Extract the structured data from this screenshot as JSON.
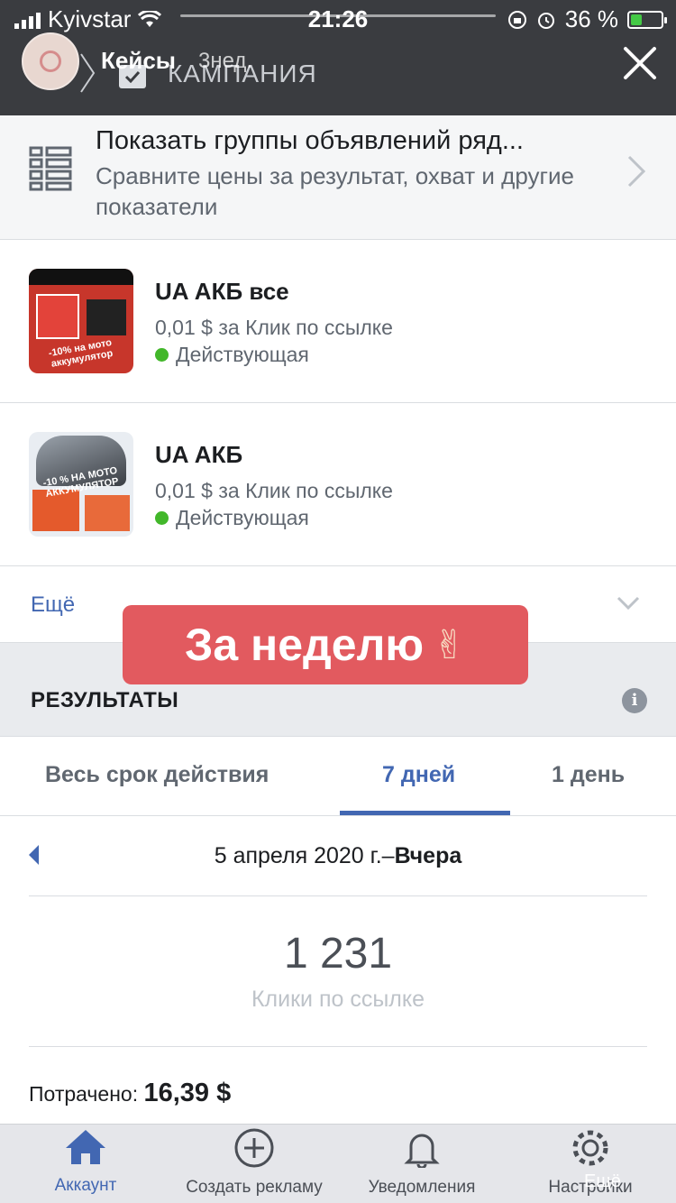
{
  "status_bar": {
    "carrier": "Kyivstar",
    "time": "21:26",
    "battery_percent": "36 %",
    "battery_level": 0.36,
    "battery_color": "#44c945"
  },
  "story_header": {
    "title": "Кейсы",
    "time_ago": "3нед.",
    "campaign_label": "КАМПАНИЯ",
    "icons": [
      "avatar",
      "chevron-right-icon",
      "checkbox-icon",
      "close-icon"
    ]
  },
  "compare_row": {
    "title": "Показать группы объявлений ряд...",
    "subtitle": "Сравните цены за результат, охват и другие показатели",
    "icon": "table-list-icon"
  },
  "ads": [
    {
      "name": "UA АКБ все",
      "price": "0,01 $ за Клик по ссылке",
      "status": "Действующая",
      "thumb_text": "-10% на мото аккумулятор"
    },
    {
      "name": "UA АКБ",
      "price": "0,01 $ за Клик по ссылке",
      "status": "Действующая",
      "thumb_text": "-10 % НА МОТО АККУМУЛЯТОР"
    }
  ],
  "more": {
    "label": "Ещё"
  },
  "sticker": {
    "text": "За неделю",
    "emoji": "✌"
  },
  "results": {
    "title": "РЕЗУЛЬТАТЫ",
    "tabs": [
      "Весь срок действия",
      "7 дней",
      "1 день"
    ],
    "active_tab": "7 дней",
    "date_range_start": "5 апреля 2020 г.–",
    "date_range_end": "Вчера",
    "metric_value": "1 231",
    "metric_label": "Клики по ссылке",
    "spent_label": "Потрачено:",
    "spent_value": "16,39 $"
  },
  "tabbar": {
    "items": [
      {
        "label": "Аккаунт",
        "icon": "home-icon"
      },
      {
        "label": "Создать рекламу",
        "icon": "plus-circle-icon"
      },
      {
        "label": "Уведомления",
        "icon": "bell-icon"
      },
      {
        "label": "Настройки",
        "icon": "gear-icon"
      }
    ],
    "active": "Аккаунт",
    "overlay_more": "Ещё"
  },
  "colors": {
    "header_bg": "#3a3c40",
    "accent": "#4267b2",
    "sticker_bg": "#e25a5f",
    "status_active": "#42b72a"
  }
}
